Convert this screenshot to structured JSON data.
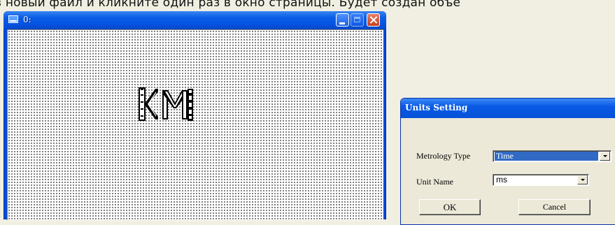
{
  "banner": {
    "text": "в новый файл и кликните один раз в окно страницы. Будет создан объе"
  },
  "window": {
    "title": "0:",
    "glyph_text": "KM"
  },
  "dialog": {
    "title": "Units Setting",
    "metrology_label": "Metrology Type",
    "metrology_value": "Time",
    "unit_label": "Unit Name",
    "unit_value": "ms",
    "ok_label": "OK",
    "cancel_label": "Cancel"
  },
  "icons": [
    "window-app-icon",
    "minimize-icon",
    "maximize-icon",
    "close-icon",
    "dropdown-arrow-icon"
  ],
  "colors": {
    "title_bar": "#0554e3",
    "selection": "#316ac5",
    "dialog_face": "#ece9d8",
    "close_button": "#c4401f"
  }
}
